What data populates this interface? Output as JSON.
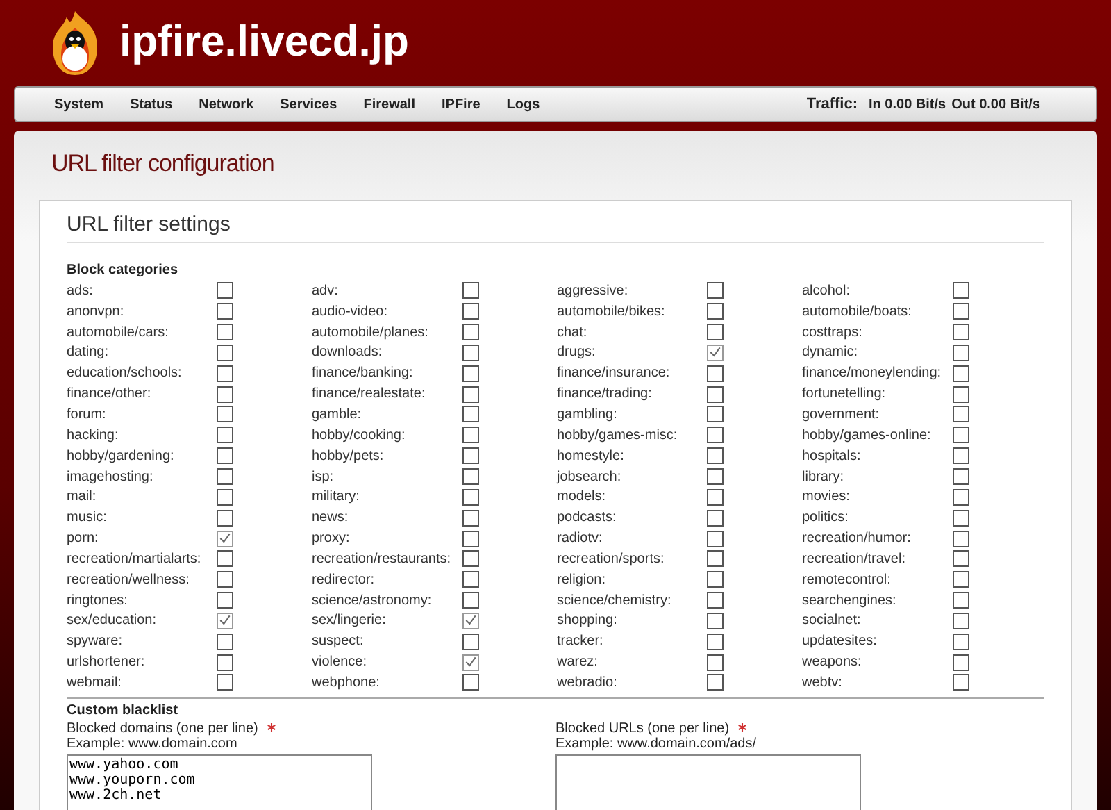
{
  "header": {
    "site_title": "ipfire.livecd.jp"
  },
  "nav": {
    "items": [
      {
        "label": "System"
      },
      {
        "label": "Status"
      },
      {
        "label": "Network"
      },
      {
        "label": "Services"
      },
      {
        "label": "Firewall"
      },
      {
        "label": "IPFire"
      },
      {
        "label": "Logs"
      }
    ],
    "traffic": {
      "label": "Traffic:",
      "in": "In 0.00 Bit/s",
      "out": "Out 0.00 Bit/s"
    }
  },
  "page_title": "URL filter configuration",
  "section_title": "URL filter settings",
  "block_categories": {
    "heading": "Block categories",
    "items": [
      {
        "label": "ads:",
        "checked": false
      },
      {
        "label": "adv:",
        "checked": false
      },
      {
        "label": "aggressive:",
        "checked": false
      },
      {
        "label": "alcohol:",
        "checked": false
      },
      {
        "label": "anonvpn:",
        "checked": false
      },
      {
        "label": "audio-video:",
        "checked": false
      },
      {
        "label": "automobile/bikes:",
        "checked": false
      },
      {
        "label": "automobile/boats:",
        "checked": false
      },
      {
        "label": "automobile/cars:",
        "checked": false
      },
      {
        "label": "automobile/planes:",
        "checked": false
      },
      {
        "label": "chat:",
        "checked": false
      },
      {
        "label": "costtraps:",
        "checked": false
      },
      {
        "label": "dating:",
        "checked": false
      },
      {
        "label": "downloads:",
        "checked": false
      },
      {
        "label": "drugs:",
        "checked": true
      },
      {
        "label": "dynamic:",
        "checked": false
      },
      {
        "label": "education/schools:",
        "checked": false
      },
      {
        "label": "finance/banking:",
        "checked": false
      },
      {
        "label": "finance/insurance:",
        "checked": false
      },
      {
        "label": "finance/moneylending:",
        "checked": false
      },
      {
        "label": "finance/other:",
        "checked": false
      },
      {
        "label": "finance/realestate:",
        "checked": false
      },
      {
        "label": "finance/trading:",
        "checked": false
      },
      {
        "label": "fortunetelling:",
        "checked": false
      },
      {
        "label": "forum:",
        "checked": false
      },
      {
        "label": "gamble:",
        "checked": false
      },
      {
        "label": "gambling:",
        "checked": false
      },
      {
        "label": "government:",
        "checked": false
      },
      {
        "label": "hacking:",
        "checked": false
      },
      {
        "label": "hobby/cooking:",
        "checked": false
      },
      {
        "label": "hobby/games-misc:",
        "checked": false
      },
      {
        "label": "hobby/games-online:",
        "checked": false
      },
      {
        "label": "hobby/gardening:",
        "checked": false
      },
      {
        "label": "hobby/pets:",
        "checked": false
      },
      {
        "label": "homestyle:",
        "checked": false
      },
      {
        "label": "hospitals:",
        "checked": false
      },
      {
        "label": "imagehosting:",
        "checked": false
      },
      {
        "label": "isp:",
        "checked": false
      },
      {
        "label": "jobsearch:",
        "checked": false
      },
      {
        "label": "library:",
        "checked": false
      },
      {
        "label": "mail:",
        "checked": false
      },
      {
        "label": "military:",
        "checked": false
      },
      {
        "label": "models:",
        "checked": false
      },
      {
        "label": "movies:",
        "checked": false
      },
      {
        "label": "music:",
        "checked": false
      },
      {
        "label": "news:",
        "checked": false
      },
      {
        "label": "podcasts:",
        "checked": false
      },
      {
        "label": "politics:",
        "checked": false
      },
      {
        "label": "porn:",
        "checked": true
      },
      {
        "label": "proxy:",
        "checked": false
      },
      {
        "label": "radiotv:",
        "checked": false
      },
      {
        "label": "recreation/humor:",
        "checked": false
      },
      {
        "label": "recreation/martialarts:",
        "checked": false
      },
      {
        "label": "recreation/restaurants:",
        "checked": false
      },
      {
        "label": "recreation/sports:",
        "checked": false
      },
      {
        "label": "recreation/travel:",
        "checked": false
      },
      {
        "label": "recreation/wellness:",
        "checked": false
      },
      {
        "label": "redirector:",
        "checked": false
      },
      {
        "label": "religion:",
        "checked": false
      },
      {
        "label": "remotecontrol:",
        "checked": false
      },
      {
        "label": "ringtones:",
        "checked": false
      },
      {
        "label": "science/astronomy:",
        "checked": false
      },
      {
        "label": "science/chemistry:",
        "checked": false
      },
      {
        "label": "searchengines:",
        "checked": false
      },
      {
        "label": "sex/education:",
        "checked": true
      },
      {
        "label": "sex/lingerie:",
        "checked": true
      },
      {
        "label": "shopping:",
        "checked": false
      },
      {
        "label": "socialnet:",
        "checked": false
      },
      {
        "label": "spyware:",
        "checked": false
      },
      {
        "label": "suspect:",
        "checked": false
      },
      {
        "label": "tracker:",
        "checked": false
      },
      {
        "label": "updatesites:",
        "checked": false
      },
      {
        "label": "urlshortener:",
        "checked": false
      },
      {
        "label": "violence:",
        "checked": true
      },
      {
        "label": "warez:",
        "checked": false
      },
      {
        "label": "weapons:",
        "checked": false
      },
      {
        "label": "webmail:",
        "checked": false
      },
      {
        "label": "webphone:",
        "checked": false
      },
      {
        "label": "webradio:",
        "checked": false
      },
      {
        "label": "webtv:",
        "checked": false
      }
    ]
  },
  "custom_blacklist": {
    "heading": "Custom blacklist",
    "fields": [
      {
        "label": "Blocked domains (one per line)",
        "required": true,
        "example": "Example: www.domain.com",
        "lines": [
          "www.yahoo.com",
          "www.youporn.com",
          "www.2ch.net"
        ]
      },
      {
        "label": "Blocked URLs (one per line)",
        "required": true,
        "example": "Example: www.domain.com/ads/"
      }
    ]
  }
}
